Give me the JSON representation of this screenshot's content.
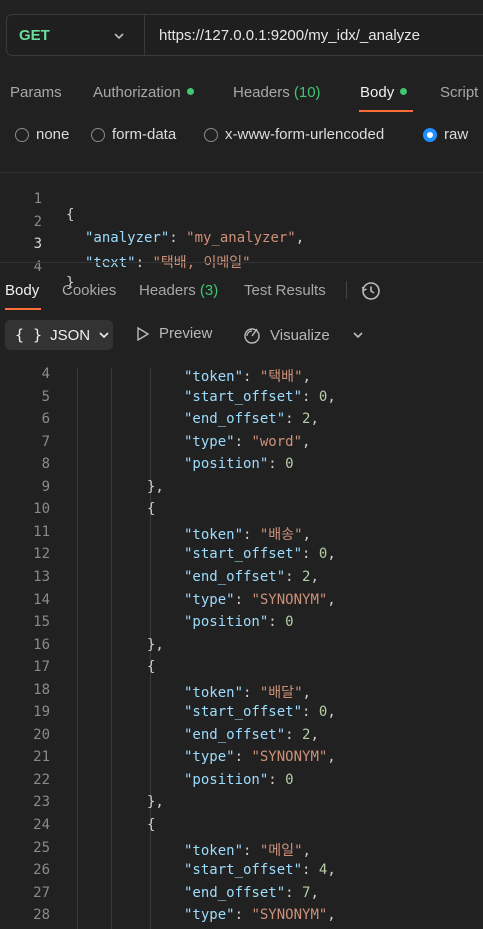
{
  "request": {
    "method": "GET",
    "url": "https://127.0.0.1:9200/my_idx/_analyze"
  },
  "request_tabs": [
    {
      "label": "Params",
      "dot": false,
      "count": "",
      "active": false
    },
    {
      "label": "Authorization",
      "dot": true,
      "count": "",
      "active": false
    },
    {
      "label": "Headers",
      "dot": false,
      "count": "(10)",
      "active": false
    },
    {
      "label": "Body",
      "dot": true,
      "count": "",
      "active": true
    },
    {
      "label": "Script",
      "dot": false,
      "count": "",
      "active": false
    }
  ],
  "body_types": [
    {
      "label": "none",
      "checked": false
    },
    {
      "label": "form-data",
      "checked": false
    },
    {
      "label": "x-www-form-urlencoded",
      "checked": false
    },
    {
      "label": "raw",
      "checked": true
    }
  ],
  "request_body": [
    {
      "n": "1",
      "text": "{"
    },
    {
      "n": "2",
      "key": "\"analyzer\"",
      "value": "\"my_analyzer\"",
      "trail": ","
    },
    {
      "n": "3",
      "key": "\"text\"",
      "value": "\"택배, 이메일\"",
      "trail": ""
    },
    {
      "n": "4",
      "text": "}"
    }
  ],
  "response_tabs": [
    {
      "label": "Body",
      "count": "",
      "active": true
    },
    {
      "label": "Cookies",
      "count": "",
      "active": false
    },
    {
      "label": "Headers",
      "count": "(3)",
      "active": false
    },
    {
      "label": "Test Results",
      "count": "",
      "active": false
    }
  ],
  "response_toolbar": {
    "format": "JSON",
    "braces": "{ }",
    "preview": "Preview",
    "visualize": "Visualize",
    "history_icon": "history-icon"
  },
  "response_lines": [
    {
      "n": "4",
      "key": "\"token\"",
      "value": "\"택배\"",
      "trail": ","
    },
    {
      "n": "5",
      "key": "\"start_offset\"",
      "num": "0",
      "trail": ","
    },
    {
      "n": "6",
      "key": "\"end_offset\"",
      "num": "2",
      "trail": ","
    },
    {
      "n": "7",
      "key": "\"type\"",
      "value": "\"word\"",
      "trail": ","
    },
    {
      "n": "8",
      "key": "\"position\"",
      "num": "0",
      "trail": ""
    },
    {
      "n": "9",
      "punct": "},"
    },
    {
      "n": "10",
      "punct": "{"
    },
    {
      "n": "11",
      "key": "\"token\"",
      "value": "\"배송\"",
      "trail": ","
    },
    {
      "n": "12",
      "key": "\"start_offset\"",
      "num": "0",
      "trail": ","
    },
    {
      "n": "13",
      "key": "\"end_offset\"",
      "num": "2",
      "trail": ","
    },
    {
      "n": "14",
      "key": "\"type\"",
      "value": "\"SYNONYM\"",
      "trail": ","
    },
    {
      "n": "15",
      "key": "\"position\"",
      "num": "0",
      "trail": ""
    },
    {
      "n": "16",
      "punct": "},"
    },
    {
      "n": "17",
      "punct": "{"
    },
    {
      "n": "18",
      "key": "\"token\"",
      "value": "\"배달\"",
      "trail": ","
    },
    {
      "n": "19",
      "key": "\"start_offset\"",
      "num": "0",
      "trail": ","
    },
    {
      "n": "20",
      "key": "\"end_offset\"",
      "num": "2",
      "trail": ","
    },
    {
      "n": "21",
      "key": "\"type\"",
      "value": "\"SYNONYM\"",
      "trail": ","
    },
    {
      "n": "22",
      "key": "\"position\"",
      "num": "0",
      "trail": ""
    },
    {
      "n": "23",
      "punct": "},"
    },
    {
      "n": "24",
      "punct": "{"
    },
    {
      "n": "25",
      "key": "\"token\"",
      "value": "\"메일\"",
      "trail": ","
    },
    {
      "n": "26",
      "key": "\"start_offset\"",
      "num": "4",
      "trail": ","
    },
    {
      "n": "27",
      "key": "\"end_offset\"",
      "num": "7",
      "trail": ","
    },
    {
      "n": "28",
      "key": "\"type\"",
      "value": "\"SYNONYM\"",
      "trail": ","
    }
  ]
}
